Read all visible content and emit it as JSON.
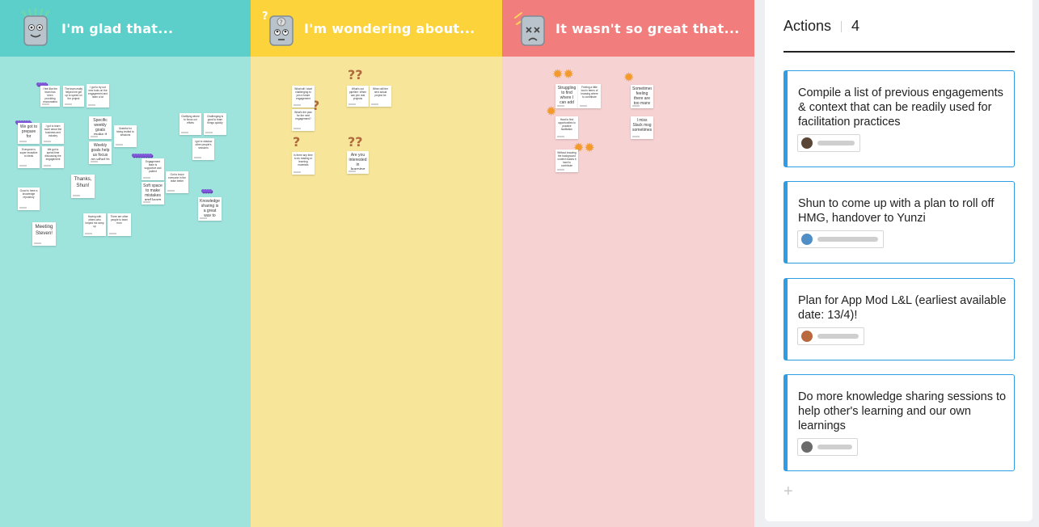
{
  "columns": [
    {
      "id": "glad",
      "title": "I'm glad that..."
    },
    {
      "id": "wonder",
      "title": "I'm wondering about..."
    },
    {
      "id": "bad",
      "title": "It wasn't so great that..."
    }
  ],
  "stickies": {
    "s1": "Thanks, Shun!",
    "s2": "Meeting Steven!",
    "s3": "We got to prepare for engagement",
    "s4": "Weekly goals help us focus on what to accomplish",
    "s5": "Soft space to make mistakes and learn and get feedback",
    "s6": "Knowledge sharing is a great way to learn",
    "s7": "Sometimes feeling there are too many meetings",
    "s8": "Struggling to find where I can add more value"
  },
  "panel": {
    "title": "Actions",
    "count": "4",
    "cards": [
      {
        "text": "Compile a list of previous engagements & context that can be readily used for facilitation practices"
      },
      {
        "text": "Shun to come up with a plan to roll off HMG, handover to Yunzi"
      },
      {
        "text": "Plan for App Mod L&L (earliest available date: 13/4)!"
      },
      {
        "text": "Do more knowledge sharing sessions to help other's learning and our own learnings"
      }
    ],
    "add_label": "+"
  },
  "colors": {
    "glad": "#5dcfca",
    "wonder": "#fcd33b",
    "bad": "#f17d7c",
    "accent": "#2f9de4"
  },
  "icons": [
    "robot-happy-icon",
    "robot-wondering-icon",
    "robot-sad-icon",
    "grapes-reaction-icon",
    "question-reaction-icon",
    "fire-reaction-icon",
    "plus-icon"
  ]
}
